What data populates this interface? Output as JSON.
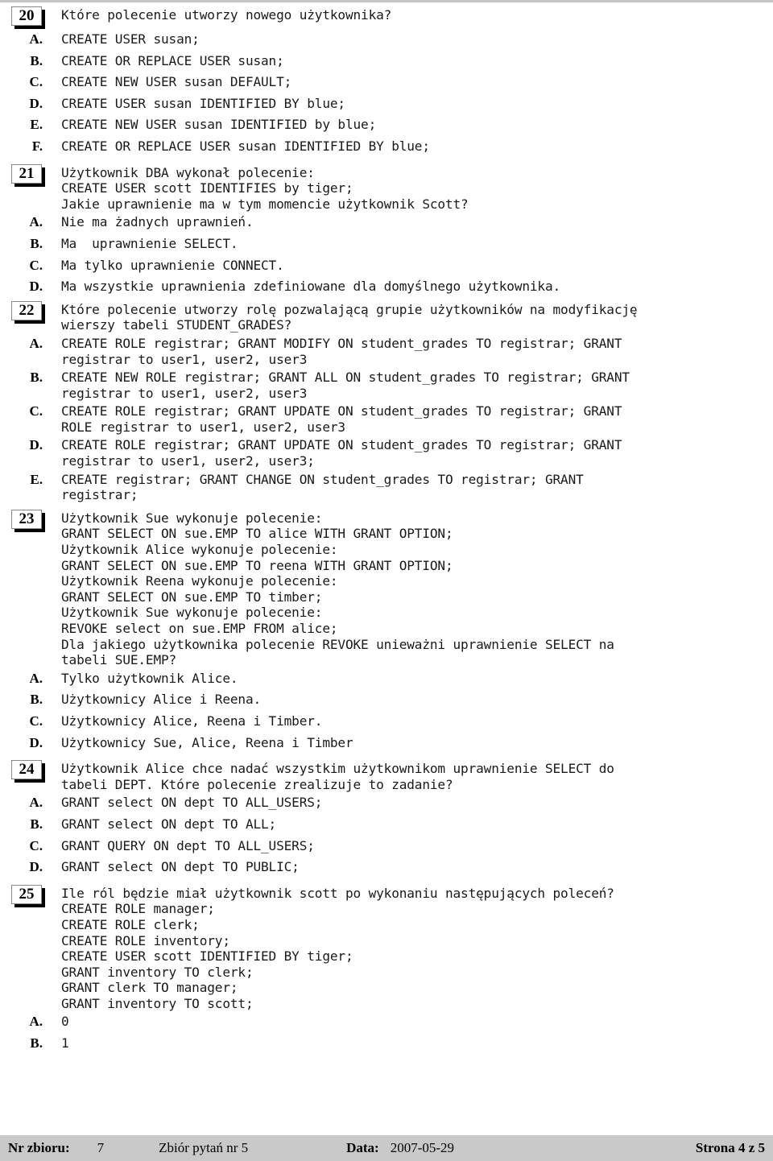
{
  "document": {
    "language": "pl",
    "top_rule_color": "#c6c6c6",
    "footer_bar_color": "#c9c9c9"
  },
  "questions": [
    {
      "number": "20",
      "stem": "Które polecenie utworzy nowego użytkownika?",
      "options": [
        {
          "letter": "A.",
          "text": "CREATE USER susan;"
        },
        {
          "letter": "B.",
          "text": "CREATE OR REPLACE USER susan;"
        },
        {
          "letter": "C.",
          "text": "CREATE NEW USER susan DEFAULT;"
        },
        {
          "letter": "D.",
          "text": "CREATE USER susan IDENTIFIED BY blue;"
        },
        {
          "letter": "E.",
          "text": "CREATE NEW USER susan IDENTIFIED by blue;"
        },
        {
          "letter": "F.",
          "text": "CREATE OR REPLACE USER susan IDENTIFIED BY blue;"
        }
      ]
    },
    {
      "number": "21",
      "stem": "Użytkownik DBA wykonał polecenie:\nCREATE USER scott IDENTIFIES by tiger;\nJakie uprawnienie ma w tym momencie użytkownik Scott?",
      "options": [
        {
          "letter": "A.",
          "text": "Nie ma żadnych uprawnień."
        },
        {
          "letter": "B.",
          "text": "Ma  uprawnienie SELECT."
        },
        {
          "letter": "C.",
          "text": "Ma tylko uprawnienie CONNECT."
        },
        {
          "letter": "D.",
          "text": "Ma wszystkie uprawnienia zdefiniowane dla domyślnego użytkownika."
        }
      ]
    },
    {
      "number": "22",
      "stem": "Które polecenie utworzy rolę pozwalającą grupie użytkowników na modyfikację\nwierszy tabeli STUDENT_GRADES?",
      "options": [
        {
          "letter": "A.",
          "text": "CREATE ROLE registrar; GRANT MODIFY ON student_grades TO registrar; GRANT\nregistrar to user1, user2, user3"
        },
        {
          "letter": "B.",
          "text": "CREATE NEW ROLE registrar; GRANT ALL ON student_grades TO registrar; GRANT\nregistrar to user1, user2, user3"
        },
        {
          "letter": "C.",
          "text": "CREATE ROLE registrar; GRANT UPDATE ON student_grades TO registrar; GRANT\nROLE registrar to user1, user2, user3"
        },
        {
          "letter": "D.",
          "text": "CREATE ROLE registrar; GRANT UPDATE ON student_grades TO registrar; GRANT\nregistrar to user1, user2, user3;"
        },
        {
          "letter": "E.",
          "text": "CREATE registrar; GRANT CHANGE ON student_grades TO registrar; GRANT\nregistrar;"
        }
      ]
    },
    {
      "number": "23",
      "stem": "Użytkownik Sue wykonuje polecenie:\nGRANT SELECT ON sue.EMP TO alice WITH GRANT OPTION;\nUżytkownik Alice wykonuje polecenie:\nGRANT SELECT ON sue.EMP TO reena WITH GRANT OPTION;\nUżytkownik Reena wykonuje polecenie:\nGRANT SELECT ON sue.EMP TO timber;\nUżytkownik Sue wykonuje polecenie:\nREVOKE select on sue.EMP FROM alice;\nDla jakiego użytkownika polecenie REVOKE unieważni uprawnienie SELECT na\ntabeli SUE.EMP?",
      "options": [
        {
          "letter": "A.",
          "text": "Tylko użytkownik Alice."
        },
        {
          "letter": "B.",
          "text": "Użytkownicy Alice i Reena."
        },
        {
          "letter": "C.",
          "text": "Użytkownicy Alice, Reena i Timber."
        },
        {
          "letter": "D.",
          "text": "Użytkownicy Sue, Alice, Reena i Timber"
        }
      ]
    },
    {
      "number": "24",
      "stem": "Użytkownik Alice chce nadać wszystkim użytkownikom uprawnienie SELECT do\ntabeli DEPT. Które polecenie zrealizuje to zadanie?",
      "options": [
        {
          "letter": "A.",
          "text": "GRANT select ON dept TO ALL_USERS;"
        },
        {
          "letter": "B.",
          "text": "GRANT select ON dept TO ALL;"
        },
        {
          "letter": "C.",
          "text": "GRANT QUERY ON dept TO ALL_USERS;"
        },
        {
          "letter": "D.",
          "text": "GRANT select ON dept TO PUBLIC;"
        }
      ]
    },
    {
      "number": "25",
      "stem": "Ile ról będzie miał użytkownik scott po wykonaniu następujących poleceń?\nCREATE ROLE manager;\nCREATE ROLE clerk;\nCREATE ROLE inventory;\nCREATE USER scott IDENTIFIED BY tiger;\nGRANT inventory TO clerk;\nGRANT clerk TO manager;\nGRANT inventory TO scott;",
      "options": [
        {
          "letter": "A.",
          "text": "0"
        },
        {
          "letter": "B.",
          "text": "1"
        }
      ]
    }
  ],
  "footer": {
    "set_label": "Nr zbioru:",
    "set_value": "7",
    "collection": "Zbiór pytań nr 5",
    "date_label": "Data:",
    "date_value": "2007-05-29",
    "page": "Strona 4 z 5"
  }
}
